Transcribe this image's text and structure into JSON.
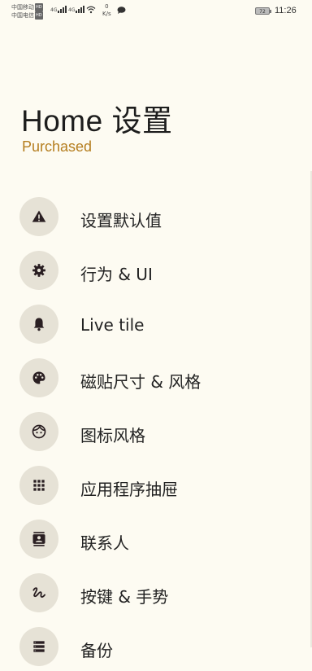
{
  "status_bar": {
    "carrier1": "中国移动",
    "carrier2": "中国电信",
    "hd_badge": "HD",
    "net_type": "4G",
    "net_speed_value": "0",
    "net_speed_unit": "K/s",
    "battery": "72",
    "time": "11:26"
  },
  "header": {
    "title": "Home 设置",
    "subtitle": "Purchased"
  },
  "menu": {
    "items": [
      {
        "label": "设置默认值",
        "icon": "warning-icon"
      },
      {
        "label": "行为 & UI",
        "icon": "gear-icon"
      },
      {
        "label": "Live tile",
        "icon": "bell-icon"
      },
      {
        "label": "磁贴尺寸 & 风格",
        "icon": "palette-icon"
      },
      {
        "label": "图标风格",
        "icon": "face-icon"
      },
      {
        "label": "应用程序抽屉",
        "icon": "apps-grid-icon"
      },
      {
        "label": "联系人",
        "icon": "contact-card-icon"
      },
      {
        "label": "按键 & 手势",
        "icon": "gesture-icon"
      },
      {
        "label": "备份",
        "icon": "storage-icon"
      }
    ]
  },
  "colors": {
    "background": "#fdfbf2",
    "accent": "#b57e1f",
    "icon_circle": "#e6e2d6",
    "icon": "#2a1f22"
  }
}
